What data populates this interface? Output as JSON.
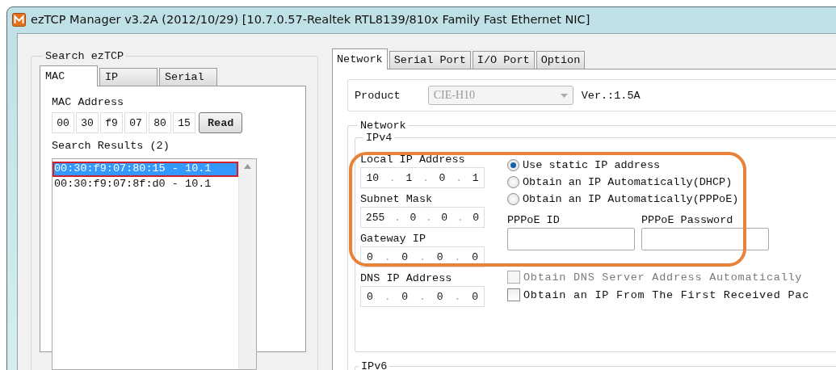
{
  "window": {
    "title": "ezTCP Manager v3.2A (2012/10/29) [10.7.0.57-Realtek RTL8139/810x Family Fast Ethernet NIC]"
  },
  "search": {
    "title": "Search ezTCP",
    "tabs": [
      {
        "label": "MAC",
        "selected": true
      },
      {
        "label": "IP",
        "selected": false
      },
      {
        "label": "Serial",
        "selected": false
      }
    ],
    "mac_label": "MAC Address",
    "mac_octets": [
      "00",
      "30",
      "f9",
      "07",
      "80",
      "15"
    ],
    "read_button": "Read",
    "results_label": "Search Results (2)",
    "results": [
      {
        "text": "00:30:f9:07:80:15 - 10.1",
        "selected": true
      },
      {
        "text": "00:30:f9:07:8f:d0 - 10.1",
        "selected": false
      }
    ]
  },
  "main_tabs": [
    {
      "label": "Network",
      "selected": true
    },
    {
      "label": "Serial Port",
      "selected": false
    },
    {
      "label": "I/O Port",
      "selected": false
    },
    {
      "label": "Option",
      "selected": false
    }
  ],
  "product": {
    "label": "Product",
    "value": "CIE-H10",
    "version": "Ver.:1.5A"
  },
  "network": {
    "title": "Network",
    "ipv4": {
      "title": "IPv4",
      "separator": ".",
      "fields": [
        {
          "label": "Local IP Address",
          "octets": [
            "10",
            "1",
            "0",
            "1"
          ]
        },
        {
          "label": "Subnet Mask",
          "octets": [
            "255",
            "0",
            "0",
            "0"
          ]
        },
        {
          "label": "Gateway IP",
          "octets": [
            "0",
            "0",
            "0",
            "0"
          ]
        },
        {
          "label": "DNS IP Address",
          "octets": [
            "0",
            "0",
            "0",
            "0"
          ]
        }
      ],
      "options": [
        {
          "label": "Use static IP address",
          "selected": true
        },
        {
          "label": "Obtain an IP Automatically(DHCP)",
          "selected": false
        },
        {
          "label": "Obtain an IP Automatically(PPPoE)",
          "selected": false
        }
      ],
      "pppoe_fields": [
        {
          "label": "PPPoE ID"
        },
        {
          "label": "PPPoE Password"
        }
      ],
      "checkboxes": [
        {
          "label": "Obtain DNS Server Address Automatically",
          "checked": false,
          "disabled": true
        },
        {
          "label": "Obtain an IP From The First Received Pac",
          "checked": false,
          "disabled": false
        }
      ]
    },
    "ipv6": {
      "title": "IPv6"
    }
  }
}
